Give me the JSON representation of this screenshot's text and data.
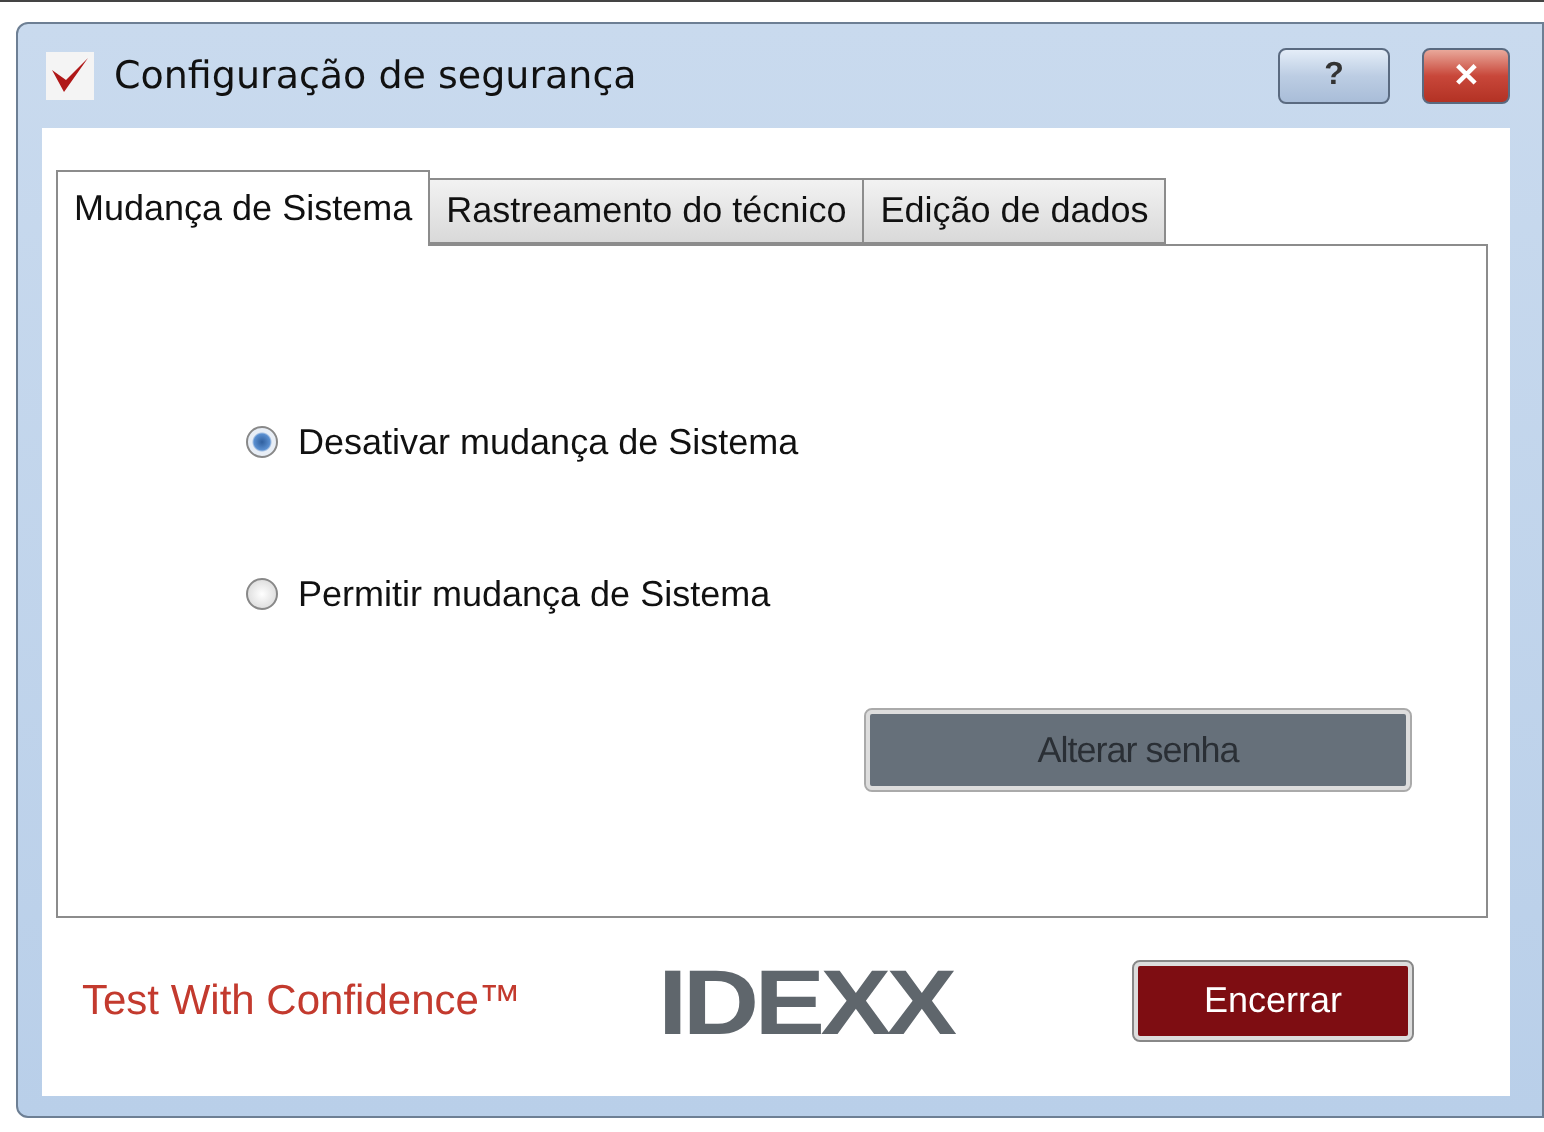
{
  "window": {
    "title": "Configuração de segurança",
    "help_button": "?",
    "close_button": "✕"
  },
  "tabs": [
    {
      "label": "Mudança de Sistema",
      "selected": true
    },
    {
      "label": "Rastreamento do técnico",
      "selected": false
    },
    {
      "label": "Edição de dados",
      "selected": false
    }
  ],
  "options": [
    {
      "label": "Desativar mudança de Sistema",
      "selected": true
    },
    {
      "label": "Permitir mudança de Sistema",
      "selected": false
    }
  ],
  "change_password_button": {
    "label": "Alterar senha",
    "disabled": true
  },
  "footer": {
    "tagline": "Test With Confidence™",
    "logo": "IDEXX",
    "close_button": "Encerrar"
  }
}
